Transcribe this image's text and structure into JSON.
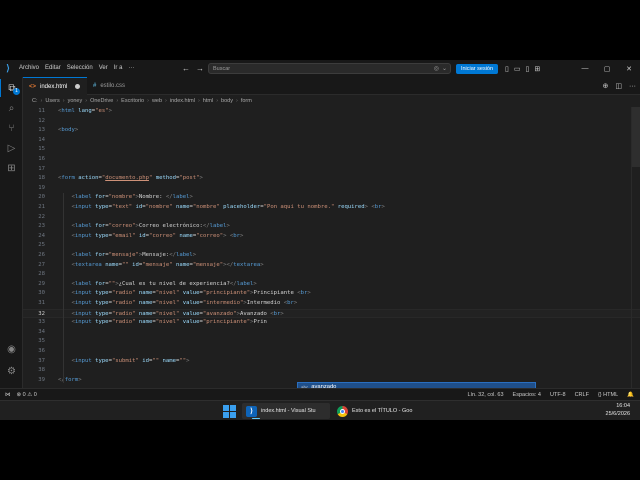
{
  "titlebar": {
    "menu": [
      "Archivo",
      "Editar",
      "Selección",
      "Ver",
      "Ir a",
      "···"
    ],
    "search_placeholder": "Buscar",
    "login_label": "Iniciar sesión"
  },
  "activity": {
    "badge_count": "1"
  },
  "tabs": [
    {
      "label": "index.html",
      "icon": "html-file-icon",
      "active": true,
      "dirty": true
    },
    {
      "label": "estilo.css",
      "icon": "css-file-icon",
      "active": false,
      "dirty": false
    }
  ],
  "breadcrumbs": [
    "C:",
    "Users",
    "yoney",
    "OneDrive",
    "Escritorio",
    "web",
    "index.html",
    "html",
    "body",
    "form"
  ],
  "editor": {
    "lines": [
      {
        "n": "11",
        "tokens": [
          [
            "br",
            "<"
          ],
          [
            "tag",
            "html"
          ],
          [
            "t",
            " "
          ],
          [
            "attr",
            "lang"
          ],
          [
            "t",
            "="
          ],
          [
            "str",
            "\"es\""
          ],
          [
            "br",
            ">"
          ]
        ]
      },
      {
        "n": "12",
        "tokens": []
      },
      {
        "n": "13",
        "tokens": [
          [
            "br",
            "<"
          ],
          [
            "tag",
            "body"
          ],
          [
            "br",
            ">"
          ]
        ]
      },
      {
        "n": "14",
        "tokens": []
      },
      {
        "n": "15",
        "tokens": []
      },
      {
        "n": "16",
        "tokens": []
      },
      {
        "n": "17",
        "tokens": []
      },
      {
        "n": "18",
        "tokens": [
          [
            "br",
            "<"
          ],
          [
            "tag",
            "form"
          ],
          [
            "t",
            " "
          ],
          [
            "attr",
            "action"
          ],
          [
            "t",
            "="
          ],
          [
            "str",
            "\""
          ],
          [
            "link",
            "documento.php"
          ],
          [
            "str",
            "\""
          ],
          [
            "t",
            " "
          ],
          [
            "attr",
            "method"
          ],
          [
            "t",
            "="
          ],
          [
            "str",
            "\"post\""
          ],
          [
            "br",
            ">"
          ]
        ]
      },
      {
        "n": "19",
        "tokens": []
      },
      {
        "n": "20",
        "tokens": [
          [
            "t",
            "    "
          ],
          [
            "br",
            "<"
          ],
          [
            "tag",
            "label"
          ],
          [
            "t",
            " "
          ],
          [
            "attr",
            "for"
          ],
          [
            "t",
            "="
          ],
          [
            "str",
            "\"nombre\""
          ],
          [
            "br",
            ">"
          ],
          [
            "t",
            "Nombre: "
          ],
          [
            "br",
            "</"
          ],
          [
            "tag",
            "label"
          ],
          [
            "br",
            ">"
          ]
        ]
      },
      {
        "n": "21",
        "tokens": [
          [
            "t",
            "    "
          ],
          [
            "br",
            "<"
          ],
          [
            "tag",
            "input"
          ],
          [
            "t",
            " "
          ],
          [
            "attr",
            "type"
          ],
          [
            "t",
            "="
          ],
          [
            "str",
            "\"text\""
          ],
          [
            "t",
            " "
          ],
          [
            "attr",
            "id"
          ],
          [
            "t",
            "="
          ],
          [
            "str",
            "\"nombre\""
          ],
          [
            "t",
            " "
          ],
          [
            "attr",
            "name"
          ],
          [
            "t",
            "="
          ],
          [
            "str",
            "\"nombre\""
          ],
          [
            "t",
            " "
          ],
          [
            "attr",
            "placeholder"
          ],
          [
            "t",
            "="
          ],
          [
            "str",
            "\"Pon aqui tu nombre.\""
          ],
          [
            "t",
            " "
          ],
          [
            "attr",
            "required"
          ],
          [
            "br",
            ">"
          ],
          [
            "t",
            " "
          ],
          [
            "br",
            "<"
          ],
          [
            "tag",
            "br"
          ],
          [
            "br",
            ">"
          ]
        ]
      },
      {
        "n": "22",
        "tokens": []
      },
      {
        "n": "23",
        "tokens": [
          [
            "t",
            "    "
          ],
          [
            "br",
            "<"
          ],
          [
            "tag",
            "label"
          ],
          [
            "t",
            " "
          ],
          [
            "attr",
            "for"
          ],
          [
            "t",
            "="
          ],
          [
            "str",
            "\"correo\""
          ],
          [
            "br",
            ">"
          ],
          [
            "t",
            "Correo electrónico:"
          ],
          [
            "br",
            "</"
          ],
          [
            "tag",
            "label"
          ],
          [
            "br",
            ">"
          ]
        ]
      },
      {
        "n": "24",
        "tokens": [
          [
            "t",
            "    "
          ],
          [
            "br",
            "<"
          ],
          [
            "tag",
            "input"
          ],
          [
            "t",
            " "
          ],
          [
            "attr",
            "type"
          ],
          [
            "t",
            "="
          ],
          [
            "str",
            "\"email\""
          ],
          [
            "t",
            " "
          ],
          [
            "attr",
            "id"
          ],
          [
            "t",
            "="
          ],
          [
            "str",
            "\"correo\""
          ],
          [
            "t",
            " "
          ],
          [
            "attr",
            "name"
          ],
          [
            "t",
            "="
          ],
          [
            "str",
            "\"correo\""
          ],
          [
            "br",
            ">"
          ],
          [
            "t",
            " "
          ],
          [
            "br",
            "<"
          ],
          [
            "tag",
            "br"
          ],
          [
            "br",
            ">"
          ]
        ]
      },
      {
        "n": "25",
        "tokens": []
      },
      {
        "n": "26",
        "tokens": [
          [
            "t",
            "    "
          ],
          [
            "br",
            "<"
          ],
          [
            "tag",
            "label"
          ],
          [
            "t",
            " "
          ],
          [
            "attr",
            "for"
          ],
          [
            "t",
            "="
          ],
          [
            "str",
            "\"mensaje\""
          ],
          [
            "br",
            ">"
          ],
          [
            "t",
            "Mensaje:"
          ],
          [
            "br",
            "</"
          ],
          [
            "tag",
            "label"
          ],
          [
            "br",
            ">"
          ]
        ]
      },
      {
        "n": "27",
        "tokens": [
          [
            "t",
            "    "
          ],
          [
            "br",
            "<"
          ],
          [
            "tag",
            "textarea"
          ],
          [
            "t",
            " "
          ],
          [
            "attr",
            "name"
          ],
          [
            "t",
            "="
          ],
          [
            "str",
            "\"\""
          ],
          [
            "t",
            " "
          ],
          [
            "attr",
            "id"
          ],
          [
            "t",
            "="
          ],
          [
            "str",
            "\"mensaje\""
          ],
          [
            "t",
            " "
          ],
          [
            "attr",
            "name"
          ],
          [
            "t",
            "="
          ],
          [
            "str",
            "\"mensaje\""
          ],
          [
            "br",
            "></"
          ],
          [
            "tag",
            "textarea"
          ],
          [
            "br",
            ">"
          ]
        ]
      },
      {
        "n": "28",
        "tokens": []
      },
      {
        "n": "29",
        "tokens": [
          [
            "t",
            "    "
          ],
          [
            "br",
            "<"
          ],
          [
            "tag",
            "label"
          ],
          [
            "t",
            " "
          ],
          [
            "attr",
            "for"
          ],
          [
            "t",
            "="
          ],
          [
            "str",
            "\"\""
          ],
          [
            "br",
            ">"
          ],
          [
            "t",
            "¿Cual es tu nivel de experiencia?"
          ],
          [
            "br",
            "</"
          ],
          [
            "tag",
            "label"
          ],
          [
            "br",
            ">"
          ]
        ]
      },
      {
        "n": "30",
        "tokens": [
          [
            "t",
            "    "
          ],
          [
            "br",
            "<"
          ],
          [
            "tag",
            "input"
          ],
          [
            "t",
            " "
          ],
          [
            "attr",
            "type"
          ],
          [
            "t",
            "="
          ],
          [
            "str",
            "\"radio\""
          ],
          [
            "t",
            " "
          ],
          [
            "attr",
            "name"
          ],
          [
            "t",
            "="
          ],
          [
            "str",
            "\"nivel\""
          ],
          [
            "t",
            " "
          ],
          [
            "attr",
            "value"
          ],
          [
            "t",
            "="
          ],
          [
            "str",
            "\"principiante\""
          ],
          [
            "br",
            ">"
          ],
          [
            "t",
            "Principiante "
          ],
          [
            "br",
            "<"
          ],
          [
            "tag",
            "br"
          ],
          [
            "br",
            ">"
          ]
        ]
      },
      {
        "n": "31",
        "tokens": [
          [
            "t",
            "    "
          ],
          [
            "br",
            "<"
          ],
          [
            "tag",
            "input"
          ],
          [
            "t",
            " "
          ],
          [
            "attr",
            "type"
          ],
          [
            "t",
            "="
          ],
          [
            "str",
            "\"radio\""
          ],
          [
            "t",
            " "
          ],
          [
            "attr",
            "name"
          ],
          [
            "t",
            "="
          ],
          [
            "str",
            "\"nivel\""
          ],
          [
            "t",
            " "
          ],
          [
            "attr",
            "value"
          ],
          [
            "t",
            "="
          ],
          [
            "str",
            "\"intermedio\""
          ],
          [
            "br",
            ">"
          ],
          [
            "t",
            "Intermedio "
          ],
          [
            "br",
            "<"
          ],
          [
            "tag",
            "br"
          ],
          [
            "br",
            ">"
          ]
        ]
      },
      {
        "n": "32",
        "current": true,
        "tokens": [
          [
            "t",
            "    "
          ],
          [
            "br",
            "<"
          ],
          [
            "tag",
            "input"
          ],
          [
            "t",
            " "
          ],
          [
            "attr",
            "type"
          ],
          [
            "t",
            "="
          ],
          [
            "str",
            "\"radio\""
          ],
          [
            "t",
            " "
          ],
          [
            "attr",
            "name"
          ],
          [
            "t",
            "="
          ],
          [
            "str",
            "\"nivel\""
          ],
          [
            "t",
            " "
          ],
          [
            "attr",
            "value"
          ],
          [
            "t",
            "="
          ],
          [
            "str",
            "\"avanzado\""
          ],
          [
            "br",
            ">"
          ],
          [
            "t",
            "Avanzado "
          ],
          [
            "br",
            "<"
          ],
          [
            "tag",
            "br"
          ],
          [
            "br",
            ">"
          ]
        ]
      },
      {
        "n": "33",
        "tokens": [
          [
            "t",
            "    "
          ],
          [
            "br",
            "<"
          ],
          [
            "tag",
            "input"
          ],
          [
            "t",
            " "
          ],
          [
            "attr",
            "type"
          ],
          [
            "t",
            "="
          ],
          [
            "str",
            "\"radio\""
          ],
          [
            "t",
            " "
          ],
          [
            "attr",
            "name"
          ],
          [
            "t",
            "="
          ],
          [
            "str",
            "\"nivel\""
          ],
          [
            "t",
            " "
          ],
          [
            "attr",
            "value"
          ],
          [
            "t",
            "="
          ],
          [
            "str",
            "\"principiante\""
          ],
          [
            "br",
            ">"
          ],
          [
            "t",
            "Prin"
          ]
        ]
      },
      {
        "n": "34",
        "tokens": []
      },
      {
        "n": "35",
        "tokens": []
      },
      {
        "n": "36",
        "tokens": []
      },
      {
        "n": "37",
        "tokens": [
          [
            "t",
            "    "
          ],
          [
            "br",
            "<"
          ],
          [
            "tag",
            "input"
          ],
          [
            "t",
            " "
          ],
          [
            "attr",
            "type"
          ],
          [
            "t",
            "="
          ],
          [
            "str",
            "\"submit\""
          ],
          [
            "t",
            " "
          ],
          [
            "attr",
            "id"
          ],
          [
            "t",
            "="
          ],
          [
            "str",
            "\"\""
          ],
          [
            "t",
            " "
          ],
          [
            "attr",
            "name"
          ],
          [
            "t",
            "="
          ],
          [
            "str",
            "\"\""
          ],
          [
            "br",
            ">"
          ]
        ]
      },
      {
        "n": "38",
        "tokens": []
      },
      {
        "n": "39",
        "tokens": [
          [
            "br",
            "</"
          ],
          [
            "tag",
            "form"
          ],
          [
            "br",
            ">"
          ]
        ]
      }
    ],
    "suggestion": {
      "kind": "abc",
      "text": "avanzado"
    }
  },
  "statusbar": {
    "errors": "0",
    "warnings": "0",
    "position": "Lín. 32, col. 63",
    "spaces": "Espacios: 4",
    "encoding": "UTF-8",
    "eol": "CRLF",
    "language": "{} HTML"
  },
  "taskbar": {
    "apps": [
      {
        "label": "index.html - Visual Stu",
        "icon": "vscode-icon",
        "active": true
      },
      {
        "label": "Esto es el TÍTULO - Goo",
        "icon": "chrome-icon",
        "active": false
      }
    ],
    "time": "16:04",
    "date": "25/6/2026"
  },
  "colors": {
    "accent": "#0078d4",
    "editor_bg": "#1f1f1f",
    "tag": "#569cd6",
    "attr": "#9cdcfe",
    "string": "#ce9178"
  }
}
